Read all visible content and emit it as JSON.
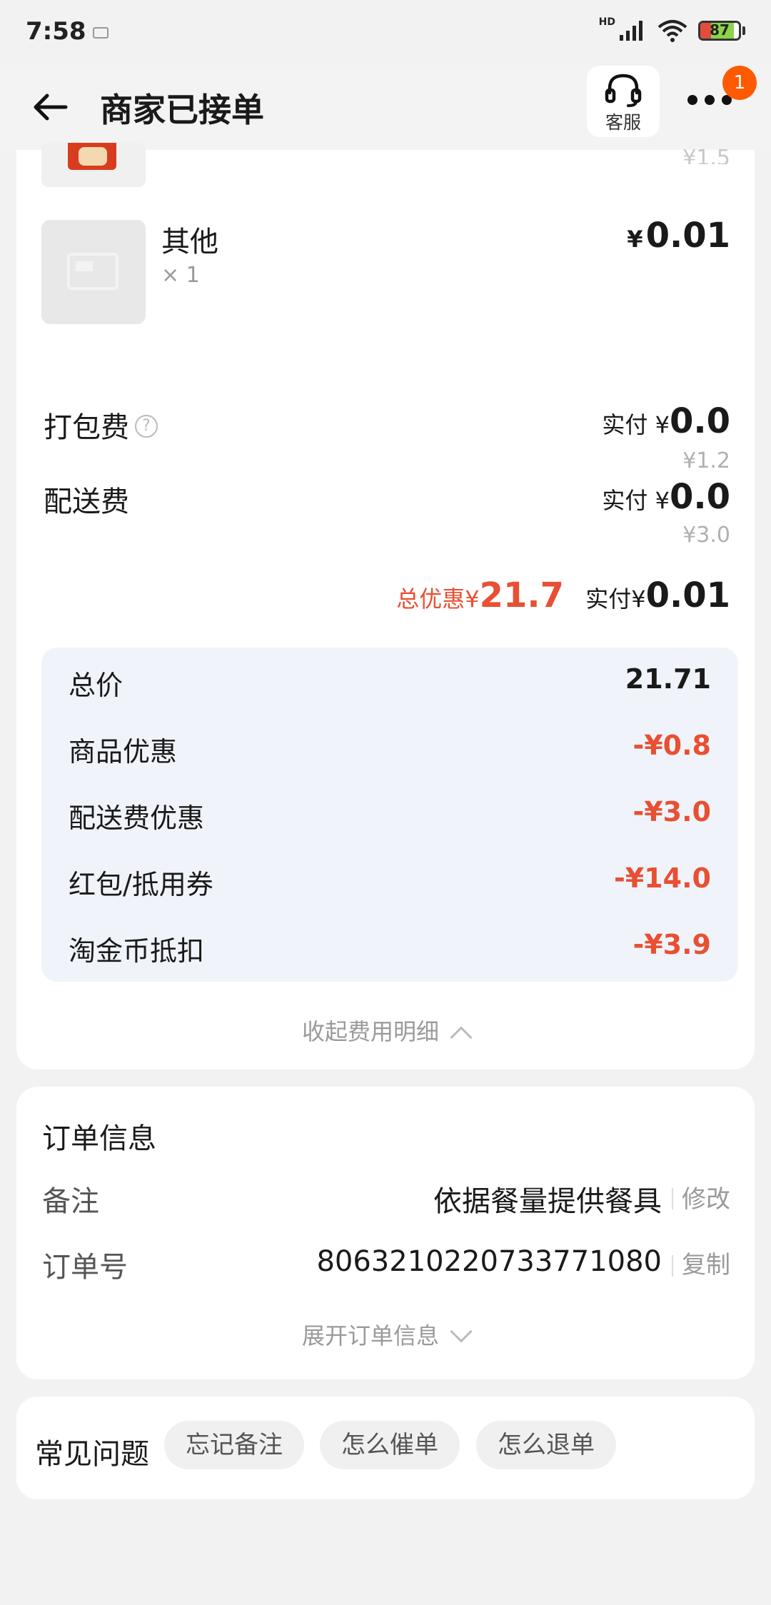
{
  "status_bar": {
    "time": "7:58",
    "network": "HD",
    "battery": "87"
  },
  "nav": {
    "title": "商家已接单",
    "service_label": "客服",
    "badge_count": "1"
  },
  "items": [
    {
      "name": "其他",
      "qty": "× 1",
      "currency": "¥",
      "price": "0.01"
    }
  ],
  "partial_item": {
    "price": "¥1.5"
  },
  "fees": [
    {
      "label": "打包费",
      "paid_prefix": "实付",
      "currency": "¥",
      "paid_value": "0.0",
      "original": "¥1.2",
      "has_help": true
    },
    {
      "label": "配送费",
      "paid_prefix": "实付",
      "currency": "¥",
      "paid_value": "0.0",
      "original": "¥3.0",
      "has_help": false
    }
  ],
  "summary": {
    "discount_label": "总优惠",
    "discount_currency": "¥",
    "discount_value": "21.7",
    "paid_label": "实付",
    "paid_currency": "¥",
    "paid_value": "0.01"
  },
  "breakdown": [
    {
      "label": "总价",
      "value": "21.71",
      "negative": false
    },
    {
      "label": "商品优惠",
      "value": "-¥0.8",
      "negative": true
    },
    {
      "label": "配送费优惠",
      "value": "-¥3.0",
      "negative": true
    },
    {
      "label": "红包/抵用券",
      "value": "-¥14.0",
      "negative": true
    },
    {
      "label": "淘金币抵扣",
      "value": "-¥3.9",
      "negative": true
    }
  ],
  "collapse_label": "收起费用明细",
  "order_info": {
    "title": "订单信息",
    "remark_label": "备注",
    "remark_value": "依据餐量提供餐具",
    "remark_action": "修改",
    "order_no_label": "订单号",
    "order_no_value": "8063210220733771080",
    "order_no_action": "复制",
    "expand_label": "展开订单信息"
  },
  "faq": {
    "title": "常见问题",
    "chips": [
      "忘记备注",
      "怎么催单",
      "怎么退单"
    ]
  },
  "colors": {
    "accent_red": "#e94f33",
    "badge_orange": "#ff5a00",
    "breakdown_bg": "#f0f4fa"
  }
}
